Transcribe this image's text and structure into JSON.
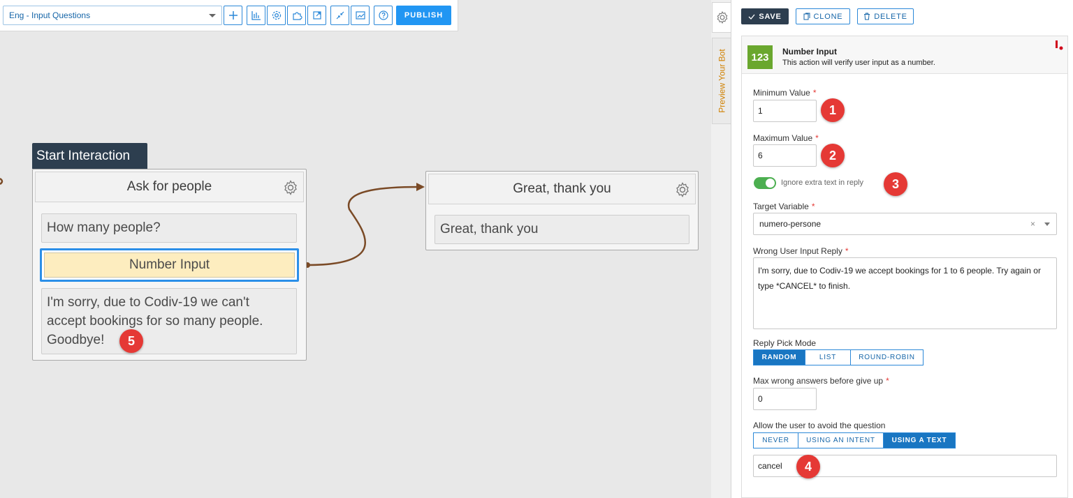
{
  "toolbar": {
    "flow_select_value": "Eng - Input Questions",
    "icons": [
      "add-icon",
      "chart-icon",
      "settings-icon",
      "puzzle-icon",
      "export-icon",
      "collapse-icon",
      "analytics-icon",
      "help-icon"
    ],
    "publish_label": "PUBLISH"
  },
  "canvas": {
    "start_tag": "Start Interaction",
    "node1": {
      "title": "Ask for people",
      "question": "How many people?",
      "input": "Number Input",
      "fallback": "I'm sorry, due to Codiv-19 we can't accept bookings for so many people. Goodbye!"
    },
    "node2": {
      "title": "Great, thank you",
      "message": "Great, thank you"
    },
    "badges": [
      "1",
      "2",
      "3",
      "4",
      "5"
    ]
  },
  "side_tabs": {
    "preview_label": "Preview Your Bot"
  },
  "panel": {
    "save_label": "SAVE",
    "clone_label": "CLONE",
    "delete_label": "DELETE",
    "action": {
      "icon_text": "123",
      "title": "Number Input",
      "description": "This action will verify user input as a number."
    },
    "min_label": "Minimum Value",
    "min_value": "1",
    "max_label": "Maximum Value",
    "max_value": "6",
    "ignore_label": "Ignore extra text in reply",
    "ignore_enabled": true,
    "target_label": "Target Variable",
    "target_value": "numero-persone",
    "wrong_label": "Wrong User Input Reply",
    "wrong_value": "I'm sorry, due to Codiv-19 we accept bookings for 1 to 6 people. Try again or type *CANCEL* to finish.",
    "pick_label": "Reply Pick Mode",
    "pick_options": [
      "RANDOM",
      "LIST",
      "ROUND-ROBIN"
    ],
    "pick_selected": "RANDOM",
    "maxwrong_label": "Max wrong answers before give up",
    "maxwrong_value": "0",
    "avoid_label": "Allow the user to avoid the question",
    "avoid_options": [
      "NEVER",
      "USING AN INTENT",
      "USING A TEXT"
    ],
    "avoid_selected": "USING A TEXT",
    "avoid_text_value": "cancel"
  },
  "colors": {
    "accent": "#2196f3",
    "dark": "#2d3e4f",
    "badge": "#e53935",
    "toggle_on": "#4caf50",
    "highlight": "#fdedbf",
    "connector": "#7a4a26"
  }
}
